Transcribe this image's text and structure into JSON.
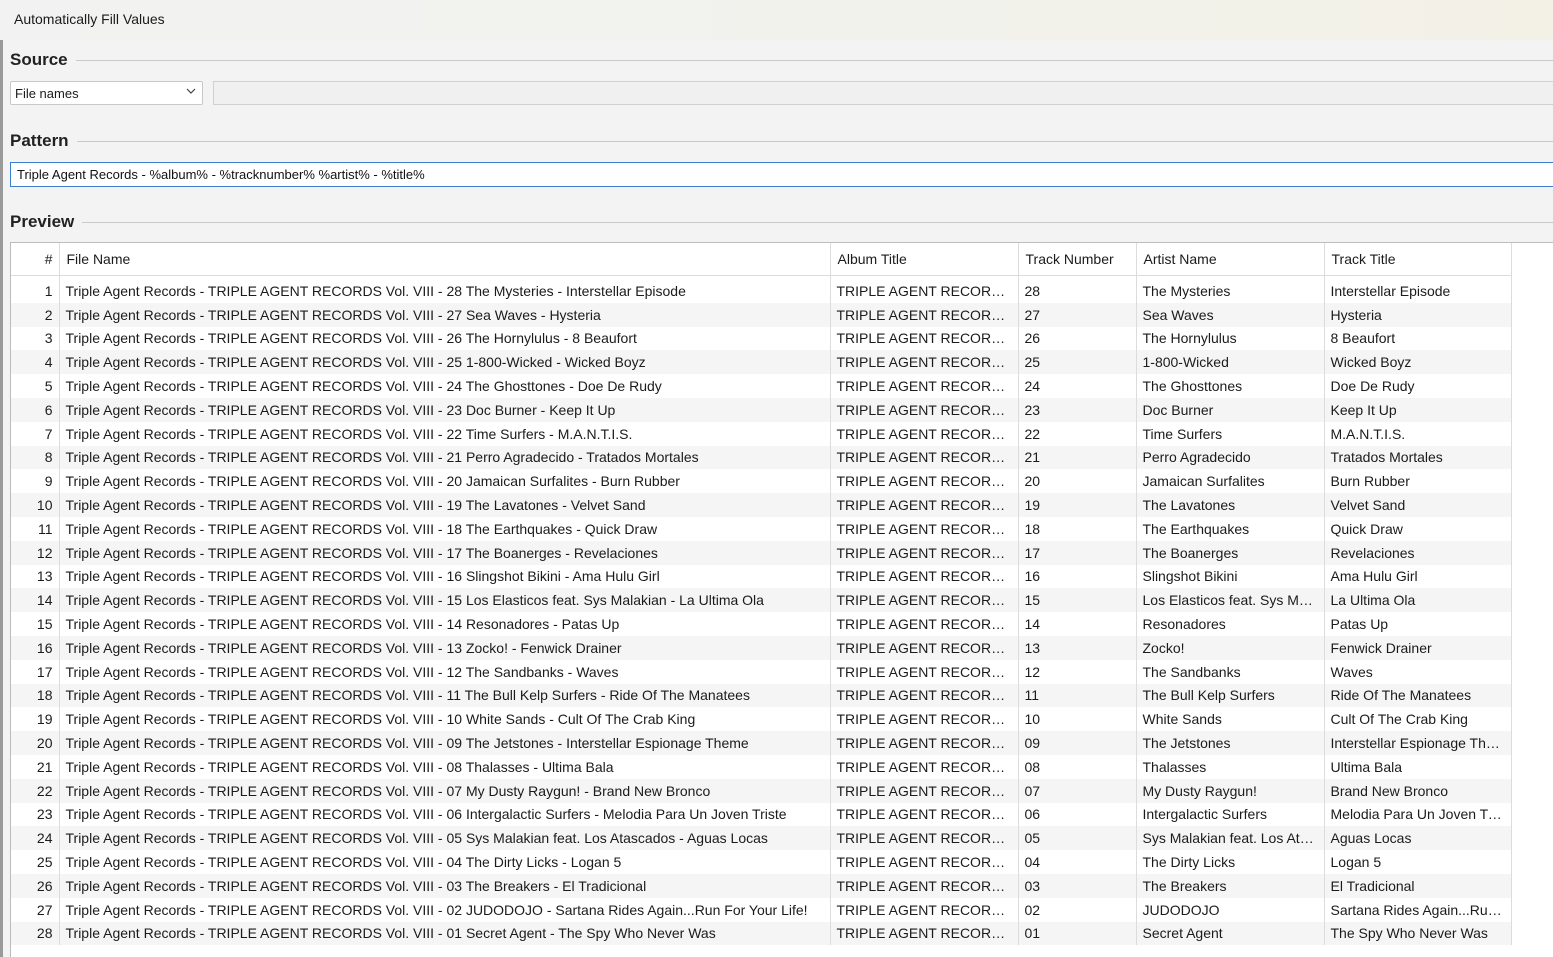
{
  "window": {
    "title": "Automatically Fill Values"
  },
  "source": {
    "heading": "Source",
    "selected": "File names",
    "field_value": ""
  },
  "pattern": {
    "heading": "Pattern",
    "value": "Triple Agent Records - %album% - %tracknumber% %artist% - %title%"
  },
  "preview": {
    "heading": "Preview",
    "columns": [
      "#",
      "File Name",
      "Album Title",
      "Track Number",
      "Artist Name",
      "Track Title"
    ],
    "rows": [
      [
        "1",
        "Triple Agent Records - TRIPLE AGENT RECORDS Vol. VIII - 28 The Mysteries - Interstellar Episode",
        "TRIPLE AGENT RECORDS Vol. VIII",
        "28",
        "The Mysteries",
        "Interstellar Episode"
      ],
      [
        "2",
        "Triple Agent Records - TRIPLE AGENT RECORDS Vol. VIII - 27 Sea Waves - Hysteria",
        "TRIPLE AGENT RECORDS Vol. VIII",
        "27",
        "Sea Waves",
        "Hysteria"
      ],
      [
        "3",
        "Triple Agent Records - TRIPLE AGENT RECORDS Vol. VIII - 26 The Hornylulus - 8 Beaufort",
        "TRIPLE AGENT RECORDS Vol. VIII",
        "26",
        "The Hornylulus",
        "8 Beaufort"
      ],
      [
        "4",
        "Triple Agent Records - TRIPLE AGENT RECORDS Vol. VIII - 25 1-800-Wicked - Wicked Boyz",
        "TRIPLE AGENT RECORDS Vol. VIII",
        "25",
        "1-800-Wicked",
        "Wicked Boyz"
      ],
      [
        "5",
        "Triple Agent Records - TRIPLE AGENT RECORDS Vol. VIII - 24 The Ghosttones - Doe De Rudy",
        "TRIPLE AGENT RECORDS Vol. VIII",
        "24",
        "The Ghosttones",
        "Doe De Rudy"
      ],
      [
        "6",
        "Triple Agent Records - TRIPLE AGENT RECORDS Vol. VIII - 23 Doc Burner - Keep It Up",
        "TRIPLE AGENT RECORDS Vol. VIII",
        "23",
        "Doc Burner",
        "Keep It Up"
      ],
      [
        "7",
        "Triple Agent Records - TRIPLE AGENT RECORDS Vol. VIII - 22 Time Surfers - M.A.N.T.I.S.",
        "TRIPLE AGENT RECORDS Vol. VIII",
        "22",
        "Time Surfers",
        "M.A.N.T.I.S."
      ],
      [
        "8",
        "Triple Agent Records - TRIPLE AGENT RECORDS Vol. VIII - 21 Perro Agradecido - Tratados Mortales",
        "TRIPLE AGENT RECORDS Vol. VIII",
        "21",
        "Perro Agradecido",
        "Tratados Mortales"
      ],
      [
        "9",
        "Triple Agent Records - TRIPLE AGENT RECORDS Vol. VIII - 20 Jamaican Surfalites - Burn Rubber",
        "TRIPLE AGENT RECORDS Vol. VIII",
        "20",
        "Jamaican Surfalites",
        "Burn Rubber"
      ],
      [
        "10",
        "Triple Agent Records - TRIPLE AGENT RECORDS Vol. VIII - 19 The Lavatones - Velvet Sand",
        "TRIPLE AGENT RECORDS Vol. VIII",
        "19",
        "The Lavatones",
        "Velvet Sand"
      ],
      [
        "11",
        "Triple Agent Records - TRIPLE AGENT RECORDS Vol. VIII - 18 The Earthquakes - Quick Draw",
        "TRIPLE AGENT RECORDS Vol. VIII",
        "18",
        "The Earthquakes",
        "Quick Draw"
      ],
      [
        "12",
        "Triple Agent Records - TRIPLE AGENT RECORDS Vol. VIII - 17 The Boanerges - Revelaciones",
        "TRIPLE AGENT RECORDS Vol. VIII",
        "17",
        "The Boanerges",
        "Revelaciones"
      ],
      [
        "13",
        "Triple Agent Records - TRIPLE AGENT RECORDS Vol. VIII - 16 Slingshot Bikini - Ama Hulu Girl",
        "TRIPLE AGENT RECORDS Vol. VIII",
        "16",
        "Slingshot Bikini",
        "Ama Hulu Girl"
      ],
      [
        "14",
        "Triple Agent Records - TRIPLE AGENT RECORDS Vol. VIII - 15 Los Elasticos feat. Sys Malakian - La Ultima Ola",
        "TRIPLE AGENT RECORDS Vol. VIII",
        "15",
        "Los Elasticos feat. Sys Malakian",
        "La Ultima Ola"
      ],
      [
        "15",
        "Triple Agent Records - TRIPLE AGENT RECORDS Vol. VIII - 14 Resonadores - Patas Up",
        "TRIPLE AGENT RECORDS Vol. VIII",
        "14",
        "Resonadores",
        "Patas Up"
      ],
      [
        "16",
        "Triple Agent Records - TRIPLE AGENT RECORDS Vol. VIII - 13 Zocko! - Fenwick Drainer",
        "TRIPLE AGENT RECORDS Vol. VIII",
        "13",
        "Zocko!",
        "Fenwick Drainer"
      ],
      [
        "17",
        "Triple Agent Records - TRIPLE AGENT RECORDS Vol. VIII - 12 The Sandbanks - Waves",
        "TRIPLE AGENT RECORDS Vol. VIII",
        "12",
        "The Sandbanks",
        "Waves"
      ],
      [
        "18",
        "Triple Agent Records - TRIPLE AGENT RECORDS Vol. VIII - 11 The Bull Kelp Surfers - Ride Of The Manatees",
        "TRIPLE AGENT RECORDS Vol. VIII",
        "11",
        "The Bull Kelp Surfers",
        "Ride Of The Manatees"
      ],
      [
        "19",
        "Triple Agent Records - TRIPLE AGENT RECORDS Vol. VIII - 10 White Sands - Cult Of The Crab King",
        "TRIPLE AGENT RECORDS Vol. VIII",
        "10",
        "White Sands",
        "Cult Of The Crab King"
      ],
      [
        "20",
        "Triple Agent Records - TRIPLE AGENT RECORDS Vol. VIII - 09 The Jetstones - Interstellar Espionage Theme",
        "TRIPLE AGENT RECORDS Vol. VIII",
        "09",
        "The Jetstones",
        "Interstellar Espionage Theme"
      ],
      [
        "21",
        "Triple Agent Records - TRIPLE AGENT RECORDS Vol. VIII - 08 Thalasses - Ultima Bala",
        "TRIPLE AGENT RECORDS Vol. VIII",
        "08",
        "Thalasses",
        "Ultima Bala"
      ],
      [
        "22",
        "Triple Agent Records - TRIPLE AGENT RECORDS Vol. VIII - 07 My Dusty Raygun! - Brand New Bronco",
        "TRIPLE AGENT RECORDS Vol. VIII",
        "07",
        "My Dusty Raygun!",
        "Brand New Bronco"
      ],
      [
        "23",
        "Triple Agent Records - TRIPLE AGENT RECORDS Vol. VIII - 06 Intergalactic Surfers - Melodia Para Un Joven Triste",
        "TRIPLE AGENT RECORDS Vol. VIII",
        "06",
        "Intergalactic Surfers",
        "Melodia Para Un Joven Triste"
      ],
      [
        "24",
        "Triple Agent Records - TRIPLE AGENT RECORDS Vol. VIII - 05 Sys Malakian feat. Los Atascados - Aguas Locas",
        "TRIPLE AGENT RECORDS Vol. VIII",
        "05",
        "Sys Malakian feat. Los Atascados",
        "Aguas Locas"
      ],
      [
        "25",
        "Triple Agent Records - TRIPLE AGENT RECORDS Vol. VIII - 04 The Dirty Licks - Logan 5",
        "TRIPLE AGENT RECORDS Vol. VIII",
        "04",
        "The Dirty Licks",
        "Logan 5"
      ],
      [
        "26",
        "Triple Agent Records - TRIPLE AGENT RECORDS Vol. VIII - 03 The Breakers - El Tradicional",
        "TRIPLE AGENT RECORDS Vol. VIII",
        "03",
        "The Breakers",
        "El Tradicional"
      ],
      [
        "27",
        "Triple Agent Records - TRIPLE AGENT RECORDS Vol. VIII - 02 JUDODOJO - Sartana Rides Again...Run For Your Life!",
        "TRIPLE AGENT RECORDS Vol. VIII",
        "02",
        "JUDODOJO",
        "Sartana Rides Again...Run For Your Life!"
      ],
      [
        "28",
        "Triple Agent Records - TRIPLE AGENT RECORDS Vol. VIII - 01 Secret Agent - The Spy Who Never Was",
        "TRIPLE AGENT RECORDS Vol. VIII",
        "01",
        "Secret Agent",
        "The Spy Who Never Was"
      ]
    ]
  }
}
